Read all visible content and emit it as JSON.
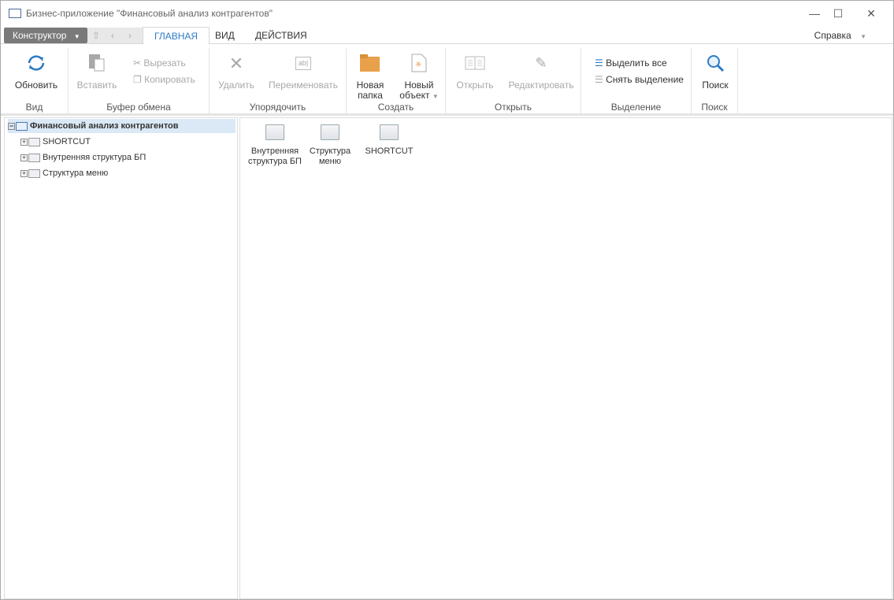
{
  "window": {
    "title": "Бизнес-приложение \"Финансовый анализ контрагентов\"",
    "minimize": "—",
    "maximize": "☐",
    "close": "✕"
  },
  "tabs_row": {
    "constructor_label": "Конструктор",
    "tabs": [
      {
        "label": "ГЛАВНАЯ",
        "active": true
      },
      {
        "label": "ВИД"
      },
      {
        "label": "ДЕЙСТВИЯ"
      }
    ],
    "help": "Справка"
  },
  "ribbon": {
    "view": {
      "refresh": "Обновить",
      "group": "Вид"
    },
    "clipboard": {
      "paste": "Вставить",
      "cut": "Вырезать",
      "copy": "Копировать",
      "group": "Буфер обмена"
    },
    "arrange": {
      "delete": "Удалить",
      "rename": "Переименовать",
      "group": "Упорядочить"
    },
    "create": {
      "new_folder_1": "Новая",
      "new_folder_2": "папка",
      "new_object_1": "Новый",
      "new_object_2": "объект",
      "group": "Создать"
    },
    "open": {
      "open": "Открыть",
      "edit": "Редактировать",
      "group": "Открыть"
    },
    "selection": {
      "select_all": "Выделить все",
      "deselect": "Снять выделение",
      "group": "Выделение"
    },
    "search": {
      "search": "Поиск",
      "group": "Поиск"
    }
  },
  "tree": {
    "root": "Финансовый анализ контрагентов",
    "children": [
      "SHORTCUT",
      "Внутренняя структура БП",
      "Структура меню"
    ]
  },
  "content": {
    "items": [
      {
        "l1": "Внутренняя",
        "l2": "структура БП"
      },
      {
        "l1": "Структура",
        "l2": "меню"
      },
      {
        "l1": "SHORTCUT",
        "l2": ""
      }
    ]
  }
}
